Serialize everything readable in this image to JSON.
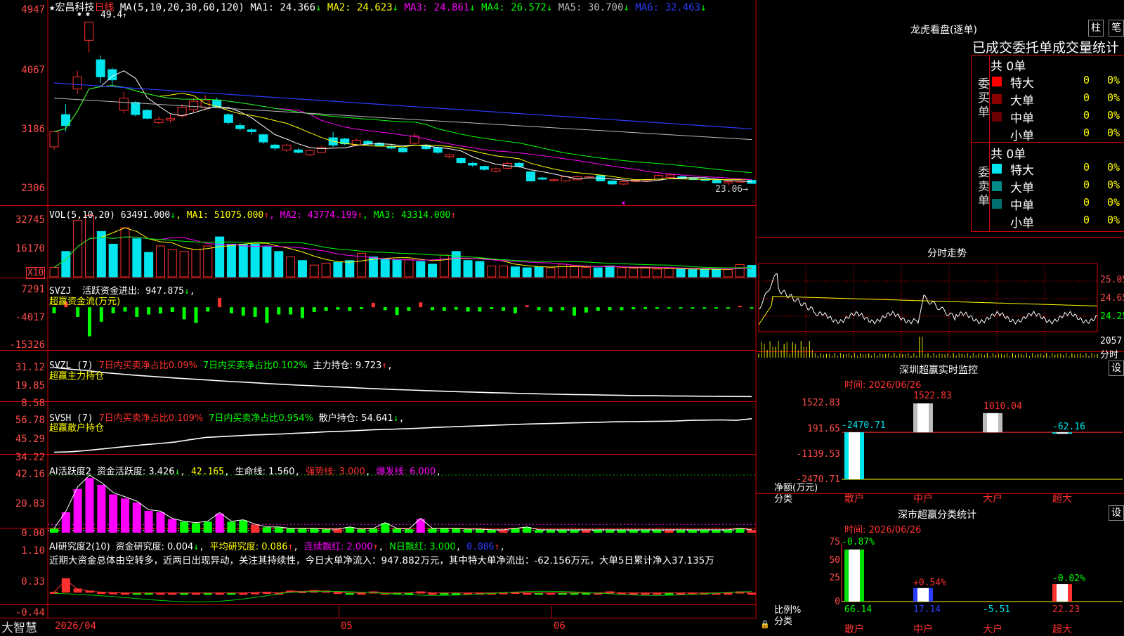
{
  "app": {
    "brand": "大智慧"
  },
  "colors": {
    "up": "#ff3030",
    "down": "#00e5ee",
    "white": "#ffffff",
    "yellow": "#ffff00",
    "magenta": "#ff00ff",
    "green": "#00ff00",
    "blue": "#2b3cff",
    "grey": "#bbbbbb",
    "grid": "#b00000"
  },
  "main": {
    "title_star": "★",
    "stock_name": "宏昌科技",
    "period": "日线",
    "ma_label": "MA(5,10,20,30,60,120)",
    "ma": [
      {
        "label": "MA1:",
        "value": "24.366",
        "arrow": "↓",
        "color": "#ffffff"
      },
      {
        "label": "MA2:",
        "value": "24.623",
        "arrow": "↓",
        "color": "#ffff00"
      },
      {
        "label": "MA3:",
        "value": "24.861",
        "arrow": "↓",
        "color": "#ff00ff"
      },
      {
        "label": "MA4:",
        "value": "26.572",
        "arrow": "↓",
        "color": "#00ff00"
      },
      {
        "label": "MA5:",
        "value": "30.700",
        "arrow": "↓",
        "color": "#bbbbbb"
      },
      {
        "label": "MA6:",
        "value": "32.463",
        "arrow": "↓",
        "color": "#2b3cff"
      }
    ],
    "high_annotation": "49.4",
    "low_annotation": "23.06→",
    "y_ticks": [
      "4947",
      "4067",
      "3186",
      "2306"
    ]
  },
  "chart_data": [
    {
      "type": "candlestick",
      "title": "宏昌科技 日线",
      "note": "approximate daily OHLC read from the chart",
      "ylim": [
        22,
        52
      ],
      "candles": [
        [
          29.5,
          32.0,
          29.0,
          31.8
        ],
        [
          34.8,
          33.0,
          32.0,
          36.5
        ],
        [
          39.0,
          41.0,
          38.2,
          42.0
        ],
        [
          47.0,
          50.0,
          45.0,
          49.4
        ],
        [
          43.8,
          41.0,
          40.0,
          44.5
        ],
        [
          42.2,
          40.5,
          39.5,
          42.5
        ],
        [
          35.5,
          37.5,
          35.0,
          38.5
        ],
        [
          36.8,
          34.8,
          34.5,
          37.0
        ],
        [
          35.5,
          34.2,
          34.0,
          35.7
        ],
        [
          33.5,
          34.0,
          33.2,
          34.5
        ],
        [
          33.9,
          34.2,
          33.5,
          34.8
        ],
        [
          34.6,
          36.0,
          34.3,
          36.5
        ],
        [
          35.6,
          37.0,
          35.2,
          37.5
        ],
        [
          36.0,
          37.2,
          35.6,
          38.0
        ],
        [
          37.2,
          36.1,
          36.0,
          37.6
        ],
        [
          34.8,
          33.5,
          33.2,
          35.0
        ],
        [
          33.0,
          32.5,
          32.2,
          33.4
        ],
        [
          32.3,
          32.0,
          31.5,
          32.6
        ],
        [
          31.5,
          30.3,
          30.0,
          31.6
        ],
        [
          29.8,
          29.3,
          28.9,
          30.0
        ],
        [
          29.0,
          29.8,
          28.7,
          30.0
        ],
        [
          29.0,
          28.6,
          28.4,
          29.3
        ],
        [
          28.2,
          28.9,
          28.0,
          29.1
        ],
        [
          28.6,
          29.4,
          28.5,
          29.6
        ],
        [
          31.0,
          29.8,
          29.5,
          32.0
        ],
        [
          30.8,
          30.0,
          29.8,
          31.0
        ],
        [
          29.8,
          30.6,
          29.6,
          30.9
        ],
        [
          30.4,
          30.0,
          29.7,
          30.7
        ],
        [
          30.1,
          29.7,
          29.6,
          30.3
        ],
        [
          29.6,
          29.3,
          29.1,
          29.8
        ],
        [
          29.3,
          28.7,
          28.5,
          29.5
        ],
        [
          30.1,
          31.3,
          29.9,
          31.8
        ],
        [
          29.8,
          29.2,
          29.0,
          30.0
        ],
        [
          29.4,
          28.6,
          28.3,
          29.6
        ],
        [
          27.9,
          28.2,
          27.6,
          28.4
        ],
        [
          27.6,
          26.9,
          26.7,
          27.8
        ],
        [
          26.8,
          26.5,
          26.2,
          27.0
        ],
        [
          26.3,
          25.8,
          25.6,
          26.4
        ],
        [
          25.5,
          25.9,
          25.3,
          26.1
        ],
        [
          26.0,
          26.8,
          25.8,
          27.0
        ],
        [
          26.8,
          26.3,
          26.1,
          27.0
        ],
        [
          25.4,
          23.9,
          23.8,
          25.5
        ],
        [
          24.4,
          24.2,
          24.0,
          24.6
        ],
        [
          24.0,
          24.1,
          23.8,
          24.3
        ],
        [
          23.9,
          24.6,
          23.7,
          24.7
        ],
        [
          24.1,
          24.6,
          24.0,
          24.8
        ],
        [
          24.5,
          24.6,
          24.3,
          24.7
        ],
        [
          24.8,
          23.9,
          23.8,
          24.9
        ],
        [
          23.9,
          23.4,
          23.3,
          24.0
        ],
        [
          23.4,
          23.8,
          23.2,
          23.9
        ],
        [
          23.9,
          24.0,
          23.7,
          24.1
        ],
        [
          24.0,
          24.1,
          23.9,
          24.2
        ],
        [
          24.2,
          24.8,
          24.1,
          25.0
        ],
        [
          24.5,
          24.9,
          24.4,
          25.0
        ],
        [
          24.6,
          24.3,
          24.2,
          24.8
        ],
        [
          24.3,
          24.2,
          24.1,
          24.4
        ],
        [
          24.2,
          24.0,
          23.9,
          24.3
        ],
        [
          24.0,
          23.6,
          23.5,
          24.1
        ],
        [
          23.6,
          23.8,
          23.2,
          23.9
        ],
        [
          23.8,
          23.9,
          23.6,
          24.1
        ],
        [
          24.0,
          23.5,
          23.4,
          24.2
        ]
      ]
    },
    {
      "type": "bar",
      "title": "VOL(5,10,20)",
      "ylim": [
        0,
        34000
      ],
      "values": [
        5200,
        14000,
        31000,
        33800,
        25000,
        18000,
        27000,
        21000,
        13500,
        17000,
        15000,
        14000,
        15000,
        17000,
        22000,
        18000,
        18000,
        18000,
        16500,
        14000,
        11000,
        9000,
        6500,
        7500,
        8000,
        9000,
        13000,
        11000,
        10000,
        9500,
        9500,
        8500,
        7000,
        12000,
        14000,
        9000,
        8500,
        6000,
        6000,
        5500,
        5000,
        5500,
        5000,
        7000,
        6000,
        5200,
        5000,
        6000,
        5000,
        4500,
        4800,
        4300,
        4500,
        4200,
        4000,
        4200,
        4200,
        4000,
        6800,
        6349
      ],
      "series": [
        {
          "name": "VOL",
          "value": "63491.000",
          "arrow": "↓"
        },
        {
          "name": "MA1",
          "value": "51075.000",
          "arrow": "↑"
        },
        {
          "name": "MA2",
          "value": "43774.199",
          "arrow": "↑"
        },
        {
          "name": "MA3",
          "value": "43314.000",
          "arrow": "↑"
        }
      ]
    },
    {
      "type": "bar",
      "title": "SVZJ",
      "ylim": [
        -15326,
        7291
      ],
      "values": [
        -2500,
        2200,
        -4000,
        -12000,
        -6000,
        -2500,
        -1800,
        -4000,
        -3000,
        -2600,
        -2000,
        -5000,
        -6500,
        -1800,
        3800,
        -2500,
        -3500,
        -4000,
        -6500,
        -3000,
        -3000,
        -4500,
        -2000,
        -1500,
        -1000,
        -1500,
        -800,
        1800,
        -1200,
        -3200,
        -1500,
        2000,
        -1200,
        -1500,
        -1000,
        -1800,
        -1800,
        -800,
        -1500,
        -2500,
        800,
        -1200,
        -1800,
        -1200,
        -3500,
        -2200,
        -1500,
        -1200,
        -1200,
        -900,
        -800,
        -700,
        -600,
        -500,
        -600,
        -600,
        -500,
        -500,
        600,
        -500
      ]
    },
    {
      "type": "line",
      "title": "SVZL (7)",
      "ylim": [
        8.58,
        31.12
      ],
      "values": [
        27.0,
        26.0,
        25.2,
        24.0,
        23.2,
        22.4,
        21.7,
        21.0,
        20.4,
        19.8,
        19.2,
        18.6,
        18.1,
        17.5,
        17.0,
        16.5,
        16.1,
        15.6,
        15.2,
        14.7,
        14.3,
        13.9,
        13.6,
        13.2,
        12.9,
        12.6,
        12.3,
        12.0,
        11.8,
        11.5,
        11.3,
        11.1,
        10.9,
        10.8,
        10.6,
        10.4,
        10.3,
        10.2,
        10.1,
        10.0,
        9.9,
        9.8,
        9.75,
        9.72
      ]
    },
    {
      "type": "line",
      "title": "SVSH (7)",
      "ylim": [
        34.22,
        56.78
      ],
      "values": [
        37.0,
        37.2,
        37.8,
        38.6,
        39.4,
        40.2,
        41.0,
        41.6,
        42.4,
        43.6,
        44.8,
        45.2,
        45.6,
        46.0,
        46.3,
        46.6,
        47.0,
        47.3,
        47.8,
        48.0,
        48.4,
        48.8,
        49.0,
        49.3,
        49.6,
        50.0,
        50.3,
        50.6,
        50.9,
        51.2,
        51.5,
        51.8,
        52.0,
        52.2,
        52.4,
        52.6,
        52.8,
        53.0,
        53.1,
        53.2,
        53.3,
        53.4,
        53.8,
        53.9,
        54.0,
        53.8,
        54.641
      ]
    },
    {
      "type": "bar",
      "title": "AI活跃度2",
      "ylim": [
        0,
        42.16
      ],
      "values": [
        3.0,
        15.0,
        32.0,
        40.0,
        35.0,
        28.0,
        25.0,
        22.0,
        16.0,
        15.0,
        10.0,
        8.0,
        7.0,
        8.0,
        14.0,
        8.0,
        9.0,
        6.0,
        4.0,
        4.0,
        3.0,
        3.0,
        3.0,
        2.5,
        2.5,
        4.0,
        2.5,
        3.0,
        7.0,
        3.0,
        2.5,
        10.0,
        3.0,
        3.0,
        3.0,
        2.5,
        2.5,
        2.0,
        2.0,
        3.0,
        4.0,
        2.0,
        2.0,
        2.0,
        2.0,
        2.0,
        2.0,
        2.0,
        2.0,
        2.0,
        2.0,
        2.0,
        2.0,
        2.0,
        2.0,
        2.0,
        2.0,
        2.0,
        3.0,
        2.0
      ]
    },
    {
      "type": "bar",
      "title": "AI研究度2(10)",
      "ylim": [
        -0.44,
        1.1
      ],
      "values": [
        0.02,
        0.35,
        0.1,
        0.05,
        0.02,
        0.01,
        0.0,
        -0.01,
        -0.02,
        0.0,
        0.0,
        -0.01,
        0.0,
        -0.01,
        0.0,
        -0.01,
        0.0,
        0.01,
        0.02,
        0.0,
        0.05,
        0.04,
        0.06,
        0.05,
        0.02,
        -0.01,
        0.0,
        0.03,
        0.0,
        -0.02,
        -0.01,
        0.03,
        0.0,
        -0.01,
        -0.01,
        0.0,
        0.0,
        0.0,
        0.01,
        0.02,
        0.0,
        -0.01,
        0.0,
        -0.01,
        -0.01,
        -0.02,
        0.0,
        0.03,
        0.0,
        0.0,
        0.0,
        0.0,
        -0.01,
        0.0,
        0.0,
        0.0,
        0.0,
        0.0,
        0.03,
        0.0
      ]
    },
    {
      "type": "bar",
      "title": "深圳超赢实时监控",
      "categories": [
        "散户",
        "中户",
        "大户",
        "超大"
      ],
      "values": [
        -2470.71,
        1522.83,
        1010.04,
        -62.16
      ],
      "ylim": [
        -2470.71,
        1522.83
      ],
      "ylabel": "净额(万元)"
    },
    {
      "type": "bar",
      "title": "深市超赢分类统计",
      "categories": [
        "散户",
        "中户",
        "大户",
        "超大"
      ],
      "values": [
        66.14,
        17.14,
        -5.51,
        22.23
      ],
      "ylim": [
        0,
        75
      ],
      "ylabel": "比例%"
    }
  ],
  "vol": {
    "title": "VOL(5,10,20)",
    "value": "63491.000",
    "arrow": "↓",
    "ma": [
      {
        "label": "MA1:",
        "value": "51075.000",
        "arrow": "↑",
        "color": "#ffff00"
      },
      {
        "label": "MA2:",
        "value": "43774.199",
        "arrow": "↑",
        "color": "#ff00ff"
      },
      {
        "label": "MA3:",
        "value": "43314.000",
        "arrow": "↑",
        "color": "#00ff00"
      }
    ],
    "y_ticks": [
      "32745",
      "16170"
    ],
    "unit": "X10"
  },
  "svzj": {
    "title": "SVZJ",
    "label": "活跃资金进出:",
    "value": "947.875",
    "arrow": "↓",
    "sub": "超赢资金流(万元)",
    "y_ticks": [
      "7291",
      "-4017",
      "-15326"
    ]
  },
  "svzl": {
    "title": "SVZL (7)",
    "p1": "7日内买卖净占比0.09%",
    "p2": "7日内买卖净占比0.102%",
    "p3": "主力持仓: 9.723",
    "arrow": "↑",
    "sub": "超赢主力持仓",
    "y_ticks": [
      "31.12",
      "19.85",
      "8.58"
    ]
  },
  "svsh": {
    "title": "SVSH (7)",
    "p1": "7日内买卖净占比0.109%",
    "p2": "7日内买卖净占比0.954%",
    "p3": "散户持仓: 54.641",
    "arrow": "↓",
    "sub": "超赢散户持仓",
    "y_ticks": [
      "56.78",
      "45.29",
      "34.22"
    ]
  },
  "ai_active": {
    "title": "AI活跃度2",
    "p1": "资金活跃度: 3.426",
    "a1": "↓",
    "p2": "42.165",
    "p3": "生命线: 1.560",
    "p4": "强势线: 3.000",
    "p5": "爆发线: 6.000",
    "y_ticks": [
      "42.16",
      "20.83",
      "0.00"
    ]
  },
  "ai_research": {
    "title": "AI研究度2(10)",
    "p1": "资金研究度: 0.004",
    "a1": "↓",
    "p2": "平均研究度: 0.086",
    "a2": "↑",
    "p3": "连续飘红: 2.000",
    "a3": "↑",
    "p4": "N日飘红: 3.000",
    "p5": "0.086",
    "a5": "↑",
    "commentary": "近期大资金总体由空转多，近两日出现异动，关注其持续性，今日大单净流入：947.882万元，其中特大单净流出：-62.156万元，大单5日累计净入37.135万",
    "y_ticks": [
      "1.10",
      "0.33",
      "-0.44"
    ]
  },
  "x_axis": {
    "labels": [
      "2026/04",
      "05",
      "06"
    ]
  },
  "right": {
    "lhb": {
      "title": "龙虎看盘(逐单)",
      "btn1": "柱",
      "btn2": "笔",
      "subtitle": "已成交委托单成交量统计",
      "buy": {
        "side_label": "委买单",
        "total": "共 0单",
        "rows": [
          {
            "label": "特大",
            "value": "0",
            "pct": "0%",
            "color": "#ff0000"
          },
          {
            "label": "大单",
            "value": "0",
            "pct": "0%",
            "color": "#8b0000"
          },
          {
            "label": "中单",
            "value": "0",
            "pct": "0%",
            "color": "#6b0000"
          },
          {
            "label": "小单",
            "value": "0",
            "pct": "0%",
            "color": ""
          }
        ]
      },
      "sell": {
        "side_label": "委卖单",
        "total": "共 0单",
        "rows": [
          {
            "label": "特大",
            "value": "0",
            "pct": "0%",
            "color": "#00e5ee"
          },
          {
            "label": "大单",
            "value": "0",
            "pct": "0%",
            "color": "#008b8b"
          },
          {
            "label": "中单",
            "value": "0",
            "pct": "0%",
            "color": "#007070"
          },
          {
            "label": "小单",
            "value": "0",
            "pct": "0%",
            "color": ""
          }
        ]
      }
    },
    "intraday": {
      "title": "分时走势",
      "y_ticks": [
        "25.05",
        "24.65",
        "24.25"
      ],
      "vol_tick": "2057",
      "vol_label": "分时"
    },
    "sz_monitor": {
      "title": "深圳超赢实时监控",
      "settings": "设",
      "time": "时间: 2026/06/26",
      "y_ticks": [
        "1522.83",
        "191.65",
        "-1139.53",
        "-2470.71"
      ],
      "ylabel": "净额(万元)",
      "xlabel": "分类",
      "categories": [
        "散户",
        "中户",
        "大户",
        "超大"
      ],
      "values": [
        -2470.71,
        1522.83,
        1010.04,
        -62.16
      ],
      "value_labels": [
        "-2470.71",
        "1522.83",
        "1010.04",
        "-62.16"
      ]
    },
    "sz_class": {
      "title": "深市超赢分类统计",
      "settings": "设",
      "time": "时间: 2026/06/26",
      "y_ticks": [
        "75",
        "50",
        "25",
        "0"
      ],
      "ylabel": "比例%",
      "xlabel": "分类",
      "categories": [
        "散户",
        "中户",
        "大户",
        "超大"
      ],
      "values": [
        66.14,
        17.14,
        -5.51,
        22.23
      ],
      "top_labels": [
        "-0.87%",
        "+0.54%",
        "",
        "-0.02%"
      ],
      "bottom_labels": [
        "66.14",
        "17.14",
        "-5.51",
        "22.23"
      ]
    }
  }
}
